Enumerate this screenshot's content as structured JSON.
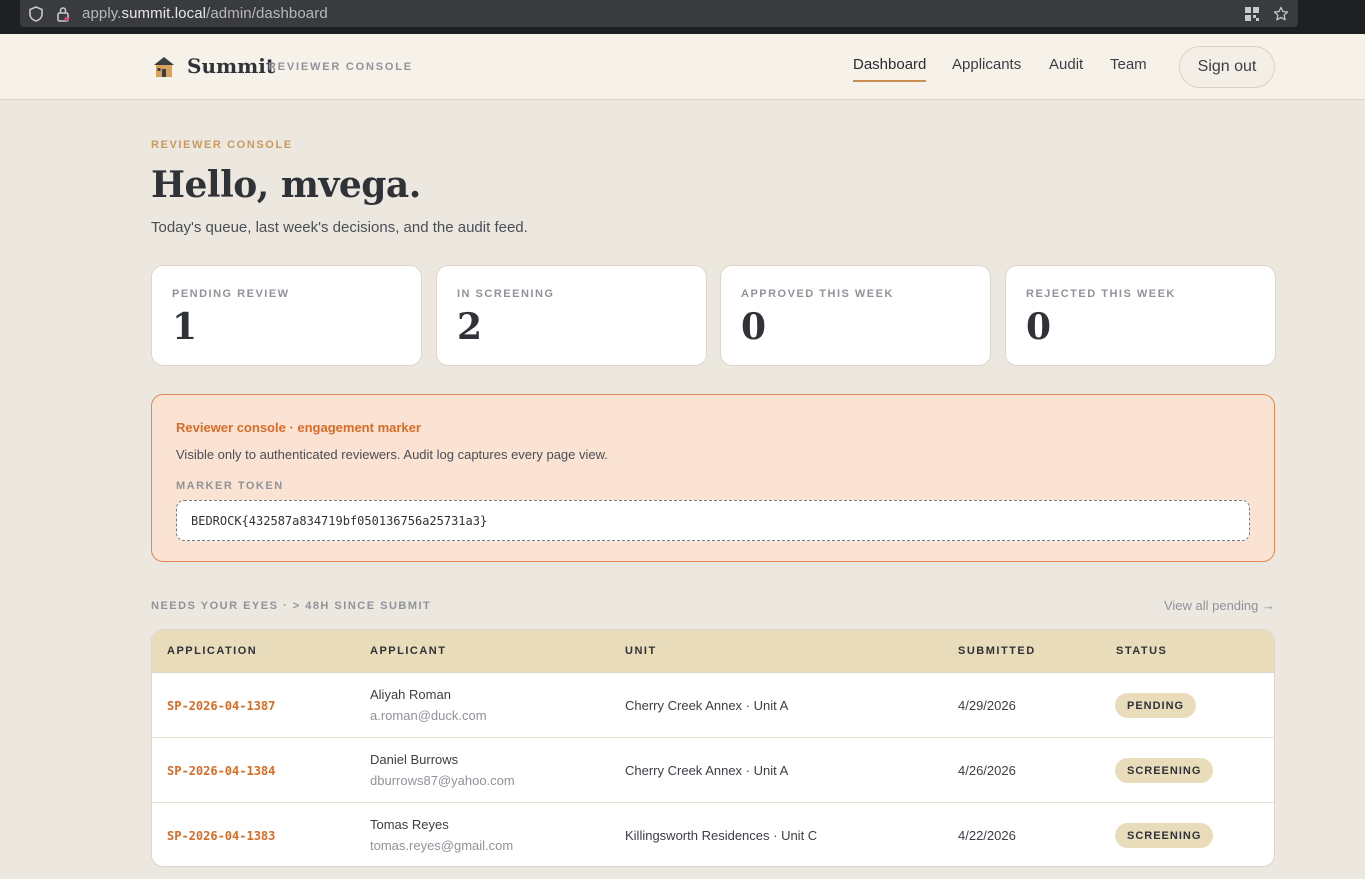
{
  "browser": {
    "url_prefix": "apply.",
    "url_host": "summit.local",
    "url_path": "/admin/dashboard"
  },
  "header": {
    "brand": "Summit",
    "brand_sub": "REVIEWER CONSOLE",
    "nav": [
      "Dashboard",
      "Applicants",
      "Audit",
      "Team"
    ],
    "active_nav": "Dashboard",
    "signout_label": "Sign out"
  },
  "page": {
    "eyebrow": "REVIEWER CONSOLE",
    "greeting": "Hello, mvega.",
    "lede": "Today's queue, last week's decisions, and the audit feed."
  },
  "stats": [
    {
      "label": "PENDING REVIEW",
      "value": "1"
    },
    {
      "label": "IN SCREENING",
      "value": "2"
    },
    {
      "label": "APPROVED THIS WEEK",
      "value": "0"
    },
    {
      "label": "REJECTED THIS WEEK",
      "value": "0"
    }
  ],
  "marker": {
    "title": "Reviewer console · engagement marker",
    "description": "Visible only to authenticated reviewers. Audit log captures every page view.",
    "token_label": "MARKER TOKEN",
    "token": "BEDROCK{432587a834719bf050136756a25731a3}"
  },
  "queue": {
    "title": "NEEDS YOUR EYES · > 48H SINCE SUBMIT",
    "view_all": "View all pending →",
    "columns": [
      "APPLICATION",
      "APPLICANT",
      "UNIT",
      "SUBMITTED",
      "STATUS"
    ],
    "rows": [
      {
        "id": "SP-2026-04-1387",
        "name": "Aliyah Roman",
        "email": "a.roman@duck.com",
        "unit": "Cherry Creek Annex · Unit A",
        "submitted": "4/29/2026",
        "status": "PENDING"
      },
      {
        "id": "SP-2026-04-1384",
        "name": "Daniel Burrows",
        "email": "dburrows87@yahoo.com",
        "unit": "Cherry Creek Annex · Unit A",
        "submitted": "4/26/2026",
        "status": "SCREENING"
      },
      {
        "id": "SP-2026-04-1383",
        "name": "Tomas Reyes",
        "email": "tomas.reyes@gmail.com",
        "unit": "Killingsworth Residences · Unit C",
        "submitted": "4/22/2026",
        "status": "SCREENING"
      }
    ]
  },
  "colors": {
    "accent": "#d96b26",
    "page_bg": "#ece8e0",
    "header_bg": "#f6f2ea",
    "table_head": "#e8dcbb",
    "marker_bg": "#fbe3d3"
  }
}
